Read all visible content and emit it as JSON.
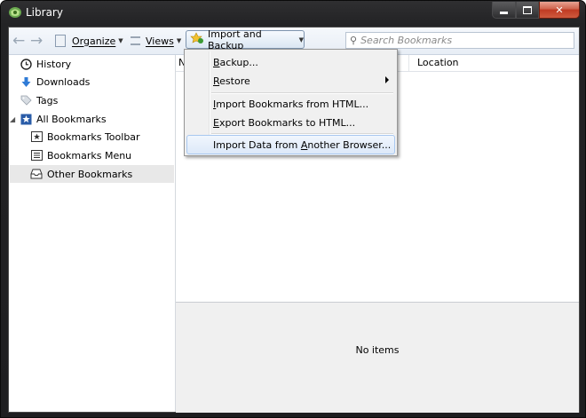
{
  "window": {
    "title": "Library",
    "controls": {
      "minimize_icon": "minimize-icon",
      "maximize_icon": "maximize-icon",
      "close_icon": "close-icon"
    }
  },
  "toolbar": {
    "organize_label": "Organize",
    "views_label": "Views",
    "import_backup_label": "Import and Backup",
    "search_placeholder": "Search Bookmarks"
  },
  "sidebar": {
    "items": [
      {
        "label": "History",
        "icon": "clock-icon"
      },
      {
        "label": "Downloads",
        "icon": "download-arrow-icon"
      },
      {
        "label": "Tags",
        "icon": "tag-icon"
      },
      {
        "label": "All Bookmarks",
        "icon": "bookmarks-icon"
      },
      {
        "label": "Bookmarks Toolbar",
        "icon": "toolbar-star-icon"
      },
      {
        "label": "Bookmarks Menu",
        "icon": "menu-list-icon"
      },
      {
        "label": "Other Bookmarks",
        "icon": "folder-tray-icon"
      }
    ]
  },
  "list": {
    "columns": [
      "N",
      "Location"
    ],
    "empty_text": "No items"
  },
  "menu": {
    "items": [
      {
        "label": "Backup...",
        "underline": "B"
      },
      {
        "label": "Restore",
        "underline": "R",
        "has_submenu": true
      },
      {
        "label": "Import Bookmarks from HTML...",
        "underline": "I"
      },
      {
        "label": "Export Bookmarks to HTML...",
        "underline": "E"
      },
      {
        "label": "Import Data from Another Browser...",
        "underline": "A"
      }
    ]
  },
  "colors": {
    "title_bar": "#232325",
    "close_button": "#c7432a",
    "toolbar_bg": "#e7edf5",
    "selected_row": "#e8e8e8",
    "menu_hover_border": "#a8c8f0"
  }
}
